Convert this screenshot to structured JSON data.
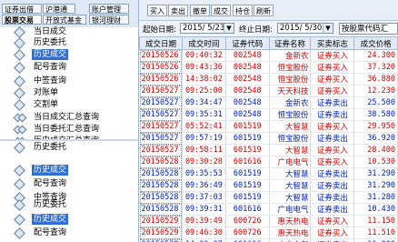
{
  "left_tabs": [
    {
      "label": "证券出借",
      "active": false
    },
    {
      "label": "沪港通",
      "active": false
    },
    {
      "label": "账户管理",
      "active": false
    },
    {
      "label": "股票交易",
      "active": true
    },
    {
      "label": "开放式基金",
      "active": false
    },
    {
      "label": "银河理财",
      "active": false
    }
  ],
  "tree_upper": [
    {
      "label": "当日成交",
      "selected": false,
      "icon": "diamond-icon"
    },
    {
      "label": "历史委托",
      "selected": false,
      "icon": "diamond-icon"
    },
    {
      "label": "历史成交",
      "selected": true,
      "icon": "diamond-icon"
    },
    {
      "label": "配号查询",
      "selected": false,
      "icon": "diamond-icon"
    },
    {
      "label": "中签查询",
      "selected": false,
      "icon": "diamond-icon"
    },
    {
      "label": "对账单",
      "selected": false,
      "icon": "diamond-icon"
    },
    {
      "label": "交割单",
      "selected": false,
      "icon": "diamond-icon"
    },
    {
      "label": "当日成交汇总查询",
      "selected": false,
      "icon": "twin-diamond-icon"
    },
    {
      "label": "当日委托汇总查询",
      "selected": false,
      "icon": "twin-diamond-icon"
    },
    {
      "label": "历史成交汇总查询",
      "selected": false,
      "icon": "twin-diamond-icon"
    }
  ],
  "tree_lower": [
    {
      "label": "历史委托",
      "selected": false,
      "icon": "diamond-icon"
    },
    {
      "label": "历史成交",
      "selected": true,
      "icon": "diamond-icon"
    },
    {
      "label": "配号查询",
      "selected": false,
      "icon": "diamond-icon"
    },
    {
      "label": "中签查询",
      "selected": false,
      "icon": "diamond-icon"
    },
    {
      "label": "历史委托",
      "selected": false,
      "icon": "diamond-icon"
    },
    {
      "label": "历史成交",
      "selected": true,
      "icon": "diamond-icon"
    },
    {
      "label": "配号查询",
      "selected": false,
      "icon": "diamond-icon"
    }
  ],
  "toolbar": {
    "buttons": [
      "买入",
      "卖出",
      "撤单",
      "成交",
      "持仓",
      "刷新"
    ]
  },
  "filter": {
    "start_label": "起始日期:",
    "start_value": "2015/ 5/23",
    "end_label": "终止日期:",
    "end_value": "2015/ 5/30",
    "query_button": "按股票代码汇"
  },
  "table": {
    "columns": [
      "成交日期",
      "成交时间",
      "证券代码",
      "证券名称",
      "买卖标志",
      "成交价格"
    ],
    "rows": [
      {
        "date": "20150526",
        "time": "09:40:32",
        "code": "002548",
        "name": "金新农",
        "flag": "证券买入",
        "price": "24.300",
        "color": "red"
      },
      {
        "date": "20150526",
        "time": "09:43:36",
        "code": "002548",
        "name": "恒宝股份",
        "flag": "证券买入",
        "price": "37.320",
        "color": "red"
      },
      {
        "date": "20150526",
        "time": "14:38:02",
        "code": "002548",
        "name": "恒宝股份",
        "flag": "证券买入",
        "price": "36.880",
        "color": "red"
      },
      {
        "date": "20150527",
        "time": "09:25:00",
        "code": "002548",
        "name": "天天科技",
        "flag": "证券买入",
        "price": "12.230",
        "color": "red"
      },
      {
        "date": "20150527",
        "time": "09:34:47",
        "code": "002548",
        "name": "金新农",
        "flag": "证券卖出",
        "price": "25.500",
        "color": "blue"
      },
      {
        "date": "20150527",
        "time": "09:35:31",
        "code": "002548",
        "name": "恒宝股份",
        "flag": "证券卖出",
        "price": "38.580",
        "color": "blue"
      },
      {
        "date": "20150527",
        "time": "05:52:41",
        "code": "601519",
        "name": "大智慧",
        "flag": "证券买入",
        "price": "29.950",
        "color": "red"
      },
      {
        "date": "20150527",
        "time": "09:57:19",
        "code": "601519",
        "name": "恒宝股份",
        "flag": "证券卖出",
        "price": "36.920",
        "color": "blue"
      },
      {
        "date": "20150527",
        "time": "09:58:11",
        "code": "601519",
        "name": "大智慧",
        "flag": "证券买入",
        "price": "28.400",
        "color": "red"
      },
      {
        "date": "20150528",
        "time": "09:30:28",
        "code": "601616",
        "name": "广电电气",
        "flag": "证券买入",
        "price": "10.530",
        "color": "red"
      },
      {
        "date": "20150528",
        "time": "09:35:53",
        "code": "601519",
        "name": "大智慧",
        "flag": "证券卖出",
        "price": "31.290",
        "color": "blue"
      },
      {
        "date": "20150528",
        "time": "09:36:49",
        "code": "601519",
        "name": "大智慧",
        "flag": "证券卖出",
        "price": "31.290",
        "color": "blue"
      },
      {
        "date": "20150528",
        "time": "09:37:03",
        "code": "601519",
        "name": "大智慧",
        "flag": "证券卖出",
        "price": "31.280",
        "color": "blue"
      },
      {
        "date": "20150528",
        "time": "09:39:31",
        "code": "601616",
        "name": "广电电气",
        "flag": "证券卖出",
        "price": "10.430",
        "color": "blue"
      },
      {
        "date": "20150529",
        "time": "09:39:49",
        "code": "600726",
        "name": "惠天热电",
        "flag": "证券买入",
        "price": "11.150",
        "color": "red"
      },
      {
        "date": "20150529",
        "time": "09:46:30",
        "code": "600726",
        "name": "惠天热电",
        "flag": "证券买入",
        "price": "11.510",
        "color": "red"
      },
      {
        "date": "20150529",
        "time": "14:02:27",
        "code": "601616",
        "name": "广电电气",
        "flag": "证券卖出",
        "price": "11.200",
        "color": "blue"
      }
    ]
  },
  "colors": {
    "buy": "#d40000",
    "sell": "#0020c0",
    "selection": "#2f6fd6"
  }
}
